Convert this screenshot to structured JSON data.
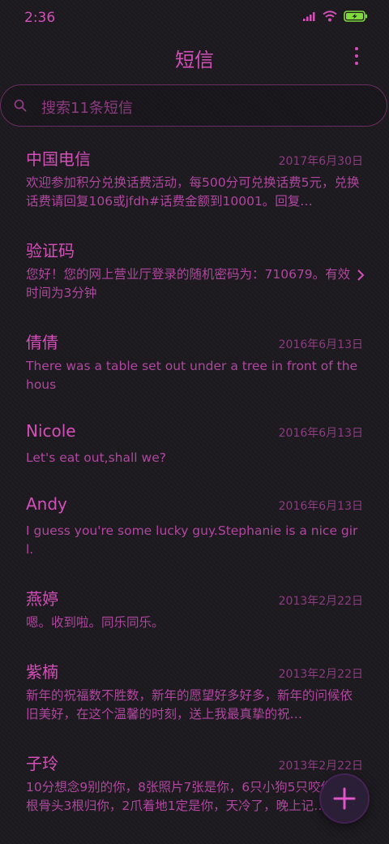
{
  "status_bar": {
    "time": "2:36"
  },
  "header": {
    "title": "短信"
  },
  "search": {
    "placeholder": "搜索11条短信"
  },
  "conversations": [
    {
      "name": "中国电信",
      "date": "2017年6月30日",
      "preview": "欢迎参加积分兑换话费活动，每500分可兑换话费5元，兑换话费请回复106或jfdh#话费金额到10001。回复…"
    },
    {
      "name": "验证码",
      "date": "",
      "preview": "您好！您的网上营业厅登录的随机密码为：710679。有效时间为3分钟"
    },
    {
      "name": "倩倩",
      "date": "2016年6月13日",
      "preview": "There was a table set out under a tree in front of the hous"
    },
    {
      "name": "Nicole",
      "date": "2016年6月13日",
      "preview": "Let's eat out,shall we?"
    },
    {
      "name": "Andy",
      "date": "2016年6月13日",
      "preview": "I guess you're some lucky guy.Stephanie is a nice girl."
    },
    {
      "name": "燕婷",
      "date": "2013年2月22日",
      "preview": "嗯。收到啦。同乐同乐。"
    },
    {
      "name": "紫楠",
      "date": "2013年2月22日",
      "preview": "新年的祝福数不胜数，新年的愿望好多好多，新年的问候依旧美好，在这个温馨的时刻，送上我最真挚的祝…"
    },
    {
      "name": "子玲",
      "date": "2013年2月22日",
      "preview": "10分想念9别的你，8张照片7张是你，6只小狗5只咬你，4根骨头3根归你，2爪着地1定是你，天冷了，晚上记…"
    }
  ],
  "colors": {
    "accent": "#d44fb8",
    "muted": "#8c3c80",
    "background": "#1c1a1f"
  },
  "icons": [
    "signal-icon",
    "wifi-icon",
    "battery-charging-icon",
    "more-vertical-icon",
    "search-icon",
    "chevron-right-icon",
    "plus-icon"
  ]
}
